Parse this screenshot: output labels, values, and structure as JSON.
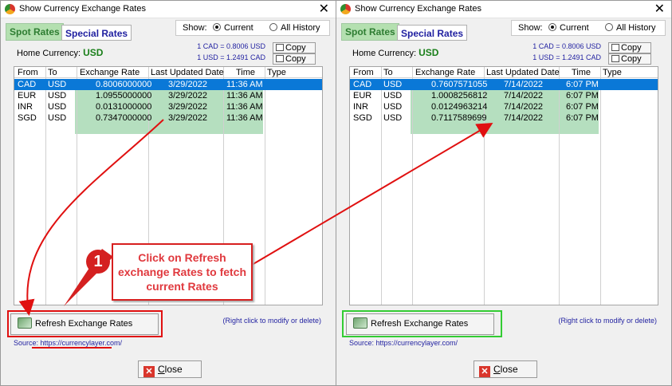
{
  "left": {
    "title": "Show Currency Exchange Rates",
    "tabs": [
      "Spot Rates",
      "Special Rates"
    ],
    "show_label": "Show:",
    "radio_current": "Current",
    "radio_all": "All History",
    "home_label": "Home Currency:",
    "home_currency": "USD",
    "rate_line1": "1 CAD = 0.8006 USD",
    "rate_line2": "1 USD = 1.2491 CAD",
    "copy_label": "Copy",
    "columns": [
      "From",
      "To",
      "Exchange Rate",
      "Last Updated Date",
      "Time",
      "Type"
    ],
    "rows": [
      {
        "from": "CAD",
        "to": "USD",
        "rate": "0.8006000000",
        "date": "3/29/2022",
        "time": "11:36 AM"
      },
      {
        "from": "EUR",
        "to": "USD",
        "rate": "1.0955000000",
        "date": "3/29/2022",
        "time": "11:36 AM"
      },
      {
        "from": "INR",
        "to": "USD",
        "rate": "0.0131000000",
        "date": "3/29/2022",
        "time": "11:36 AM"
      },
      {
        "from": "SGD",
        "to": "USD",
        "rate": "0.7347000000",
        "date": "3/29/2022",
        "time": "11:36 AM"
      }
    ],
    "refresh_label": "Refresh Exchange Rates",
    "right_click_hint": "(Right click to modify or delete)",
    "source": "Source: https://currencylayer.com/",
    "close_label": "lose",
    "close_accel": "C"
  },
  "right": {
    "title": "Show Currency Exchange Rates",
    "tabs": [
      "Spot Rates",
      "Special Rates"
    ],
    "show_label": "Show:",
    "radio_current": "Current",
    "radio_all": "All History",
    "home_label": "Home Currency:",
    "home_currency": "USD",
    "rate_line1": "1 CAD = 0.8006 USD",
    "rate_line2": "1 USD = 1.2491 CAD",
    "copy_label": "Copy",
    "columns": [
      "From",
      "To",
      "Exchange Rate",
      "Last Updated Date",
      "Time",
      "Type"
    ],
    "rows": [
      {
        "from": "CAD",
        "to": "USD",
        "rate": "0.7607571055",
        "date": "7/14/2022",
        "time": "6:07 PM"
      },
      {
        "from": "EUR",
        "to": "USD",
        "rate": "1.0008256812",
        "date": "7/14/2022",
        "time": "6:07 PM"
      },
      {
        "from": "INR",
        "to": "USD",
        "rate": "0.0124963214",
        "date": "7/14/2022",
        "time": "6:07 PM"
      },
      {
        "from": "SGD",
        "to": "USD",
        "rate": "0.7117589699",
        "date": "7/14/2022",
        "time": "6:07 PM"
      }
    ],
    "refresh_label": "Refresh Exchange Rates",
    "right_click_hint": "(Right click to modify or delete)",
    "source": "Source: https://currencylayer.com/",
    "close_label": "lose",
    "close_accel": "C"
  },
  "annotation": {
    "badge": "1",
    "callout": "Click on Refresh exchange Rates to fetch current Rates",
    "highlight_color": "#e01010",
    "success_color": "#33cc33",
    "grid_highlight": "#a8d9b4",
    "selection_color": "#0a78d7"
  }
}
